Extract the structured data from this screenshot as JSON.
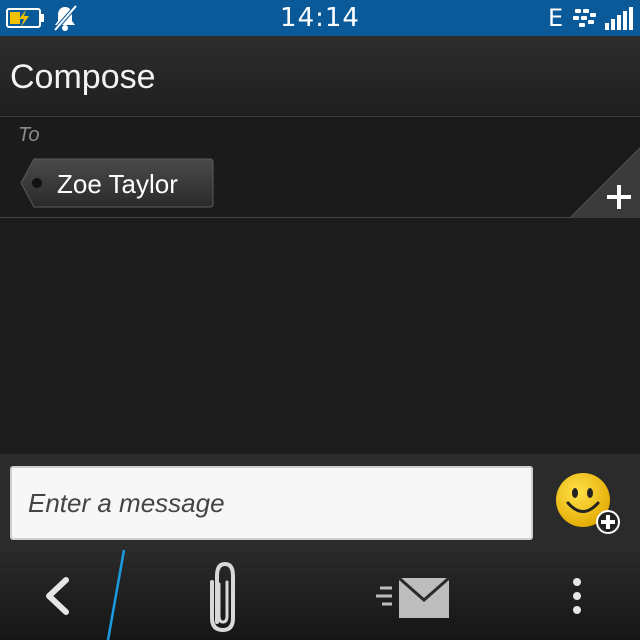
{
  "status_bar": {
    "time": "14:14",
    "network_type": "E",
    "icons": [
      "battery-charging-icon",
      "notifications-muted-icon",
      "bbm-icon",
      "signal-strength-icon"
    ]
  },
  "header": {
    "title": "Compose"
  },
  "recipients": {
    "to_label": "To",
    "items": [
      {
        "name": "Zoe Taylor"
      }
    ],
    "add_icon": "plus-icon"
  },
  "composer": {
    "placeholder": "Enter a message",
    "value": "",
    "emoticon_icon": "smiley-add-icon"
  },
  "action_bar": {
    "items": [
      "back-icon",
      "attachment-icon",
      "send-icon",
      "overflow-menu-icon"
    ],
    "accent_color": "#1a9be0"
  },
  "colors": {
    "status_bar": "#0a5a9a",
    "background": "#1c1c1c",
    "battery_charge": "#f2c200",
    "smiley": "#f4c600"
  }
}
